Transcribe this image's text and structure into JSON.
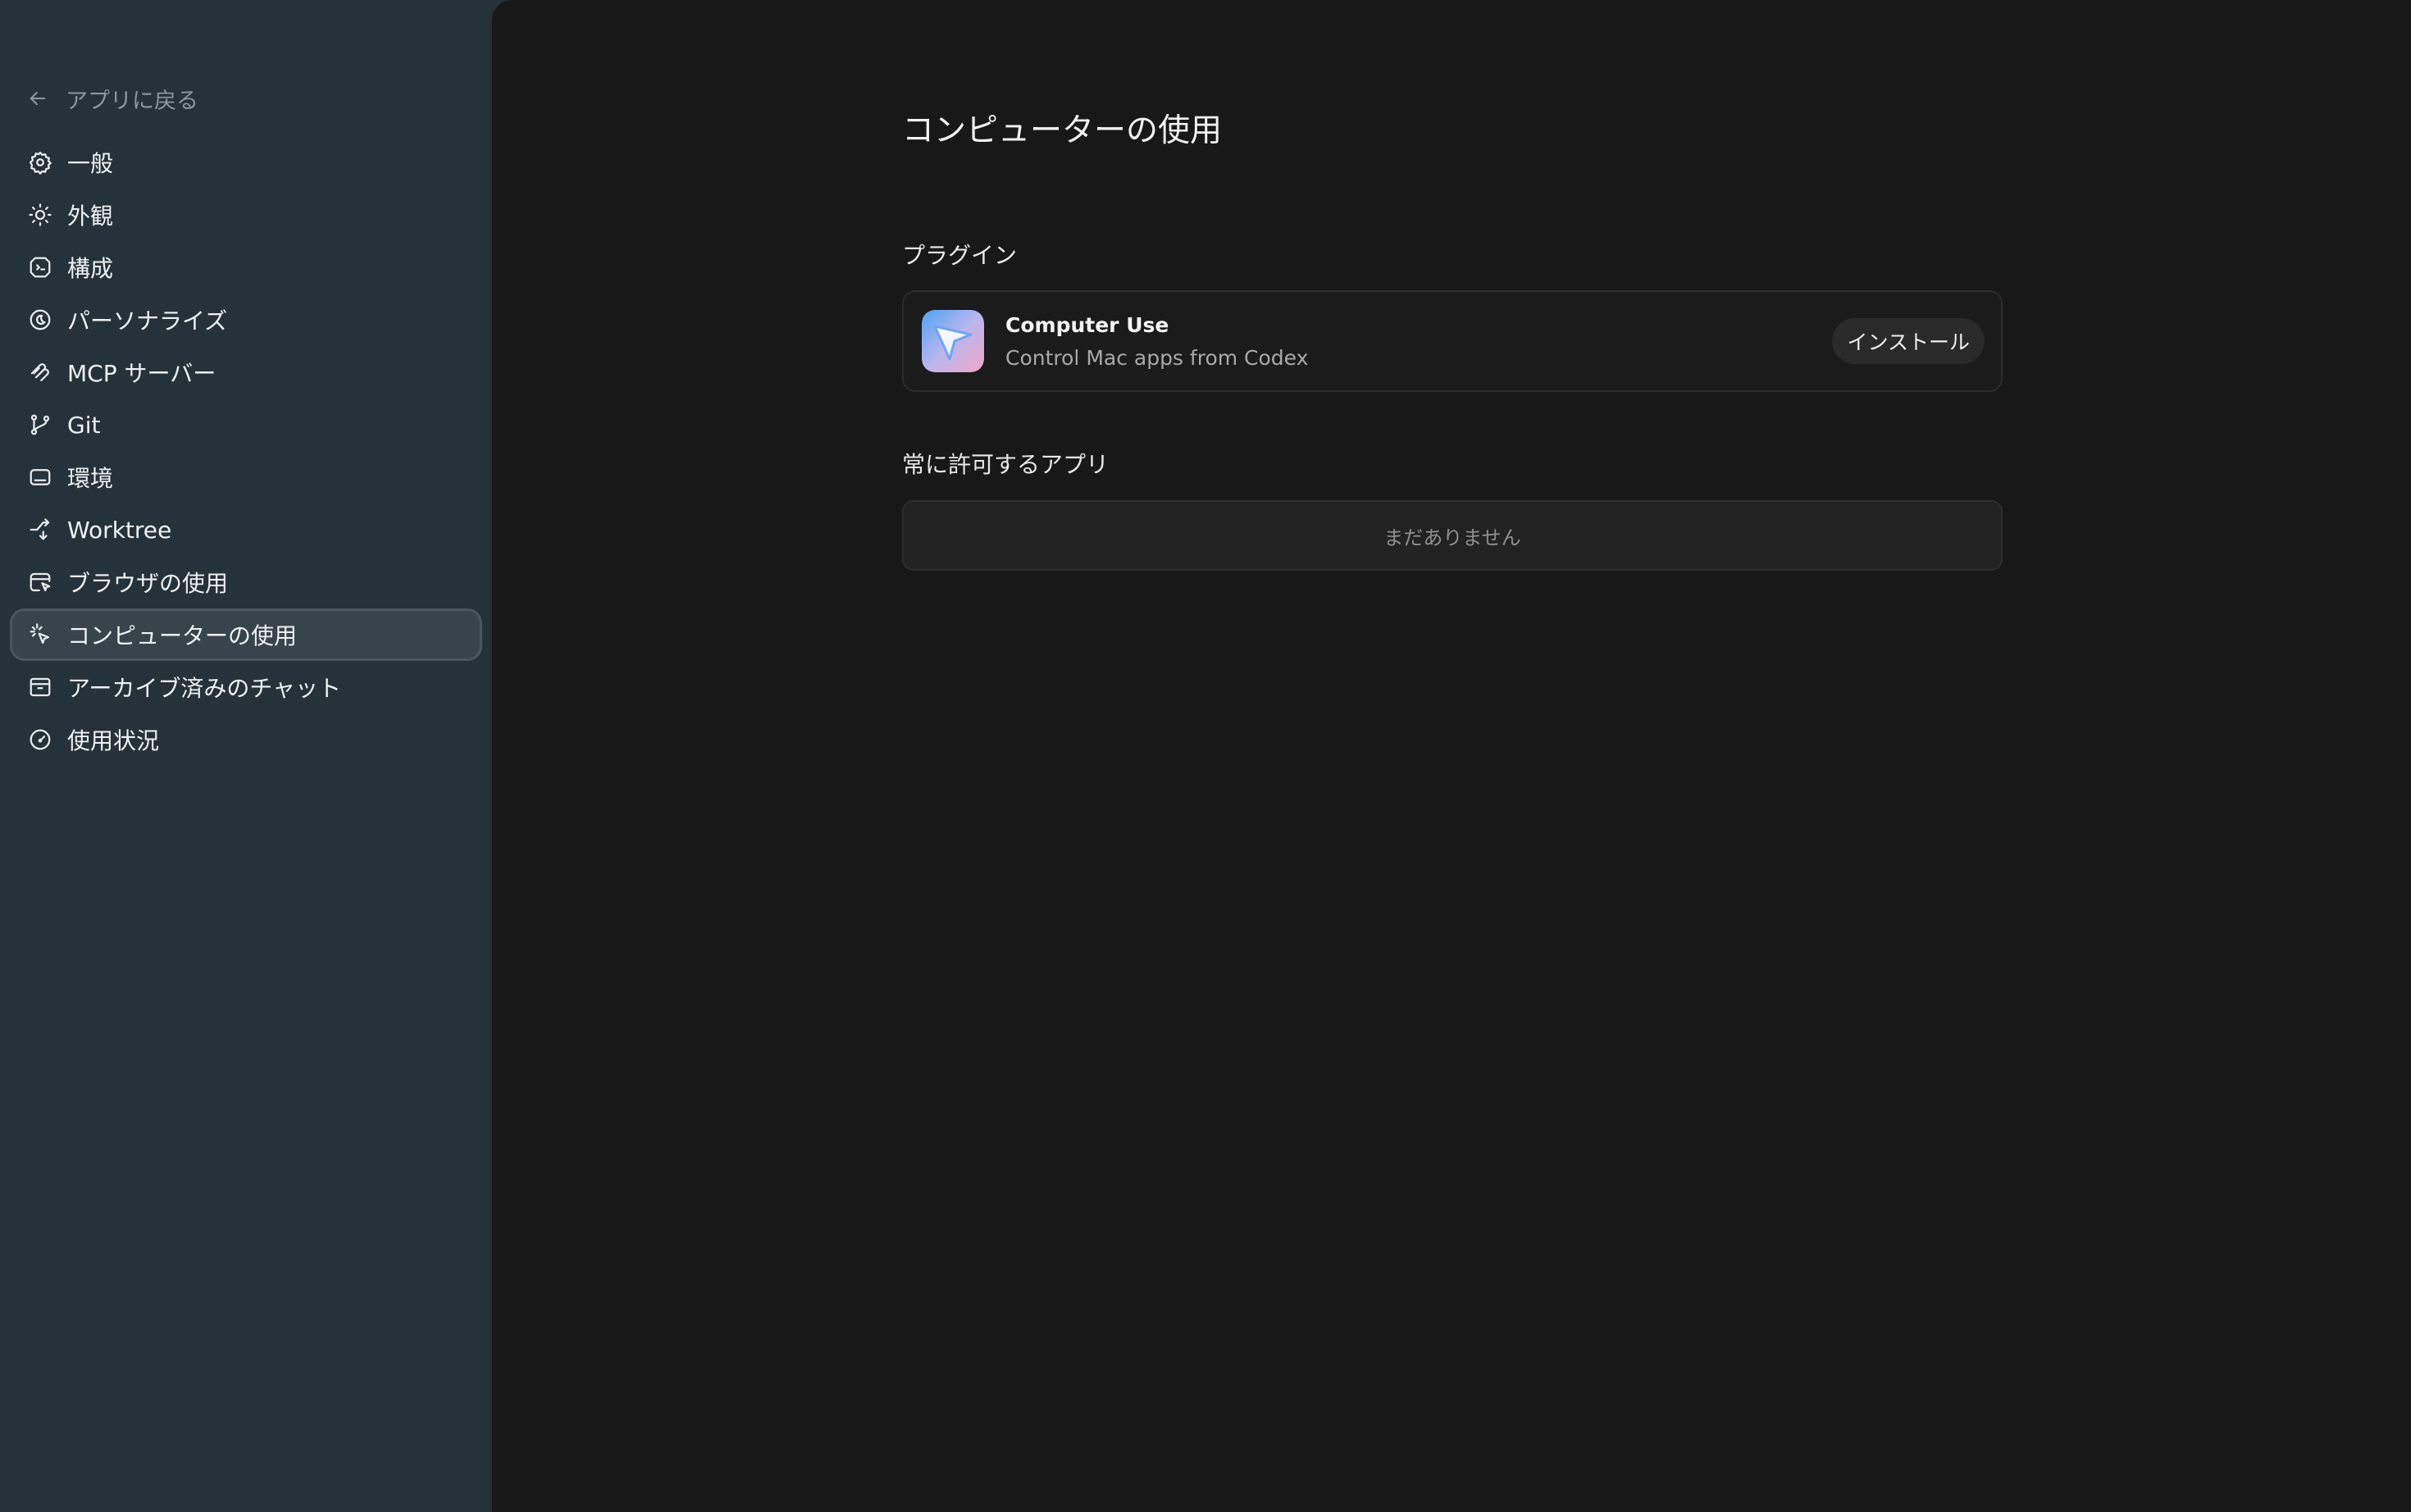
{
  "sidebar": {
    "back_label": "アプリに戻る",
    "items": [
      {
        "label": "一般",
        "icon": "gear-icon"
      },
      {
        "label": "外観",
        "icon": "sun-icon"
      },
      {
        "label": "構成",
        "icon": "config-shield-icon"
      },
      {
        "label": "パーソナライズ",
        "icon": "personalize-icon"
      },
      {
        "label": "MCP サーバー",
        "icon": "mcp-icon"
      },
      {
        "label": "Git",
        "icon": "git-branch-icon"
      },
      {
        "label": "環境",
        "icon": "terminal-window-icon"
      },
      {
        "label": "Worktree",
        "icon": "worktree-icon"
      },
      {
        "label": "ブラウザの使用",
        "icon": "browser-cursor-icon"
      },
      {
        "label": "コンピューターの使用",
        "icon": "computer-use-cursor-icon",
        "active": true
      },
      {
        "label": "アーカイブ済みのチャット",
        "icon": "archive-icon"
      },
      {
        "label": "使用状況",
        "icon": "gauge-icon"
      }
    ]
  },
  "main": {
    "title": "コンピューターの使用",
    "plugins_heading": "プラグイン",
    "plugin": {
      "name": "Computer Use",
      "description": "Control Mac apps from Codex",
      "install_label": "インストール"
    },
    "allowed_heading": "常に許可するアプリ",
    "allowed_empty": "まだありません"
  },
  "colors": {
    "sidebar_bg": "#263239",
    "main_bg": "#181818",
    "active_item_bg": "#38444b"
  }
}
